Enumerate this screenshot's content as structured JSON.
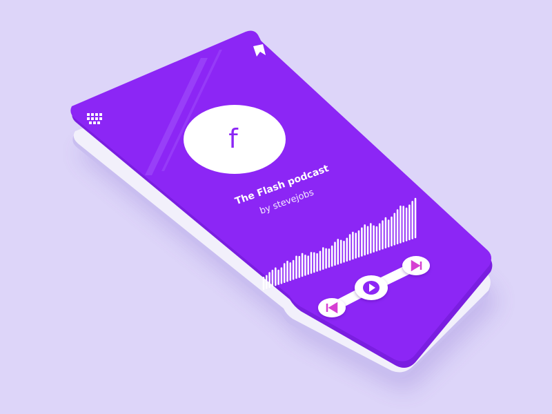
{
  "colors": {
    "background": "#ddd5f9",
    "card": "#8c26f5",
    "card_edge": "#7a1ee0",
    "lower_card": "#f2f0fb",
    "white": "#ffffff",
    "accent": "#d63fd2",
    "icon_accent": "#8c26f5"
  },
  "podcast": {
    "logo_letter": "f",
    "title": "The Flash podcast",
    "author": "by stevejobs"
  },
  "icons": {
    "menu": "grid-icon",
    "bookmark": "bookmark-icon",
    "previous": "skip-previous-icon",
    "play": "play-icon",
    "next": "skip-next-icon"
  },
  "waveform": {
    "levels": [
      0.18,
      0.2,
      0.26,
      0.3,
      0.34,
      0.24,
      0.28,
      0.38,
      0.42,
      0.34,
      0.38,
      0.48,
      0.44,
      0.5,
      0.42,
      0.36,
      0.44,
      0.4,
      0.34,
      0.38,
      0.46,
      0.4,
      0.36,
      0.42,
      0.5,
      0.56,
      0.5,
      0.44,
      0.5,
      0.58,
      0.62,
      0.56,
      0.6,
      0.66,
      0.72,
      0.64,
      0.7,
      0.6,
      0.54,
      0.6,
      0.66,
      0.72,
      0.62,
      0.68,
      0.76,
      0.84,
      0.92,
      0.88,
      0.8,
      0.86,
      0.94,
      1.0
    ]
  }
}
